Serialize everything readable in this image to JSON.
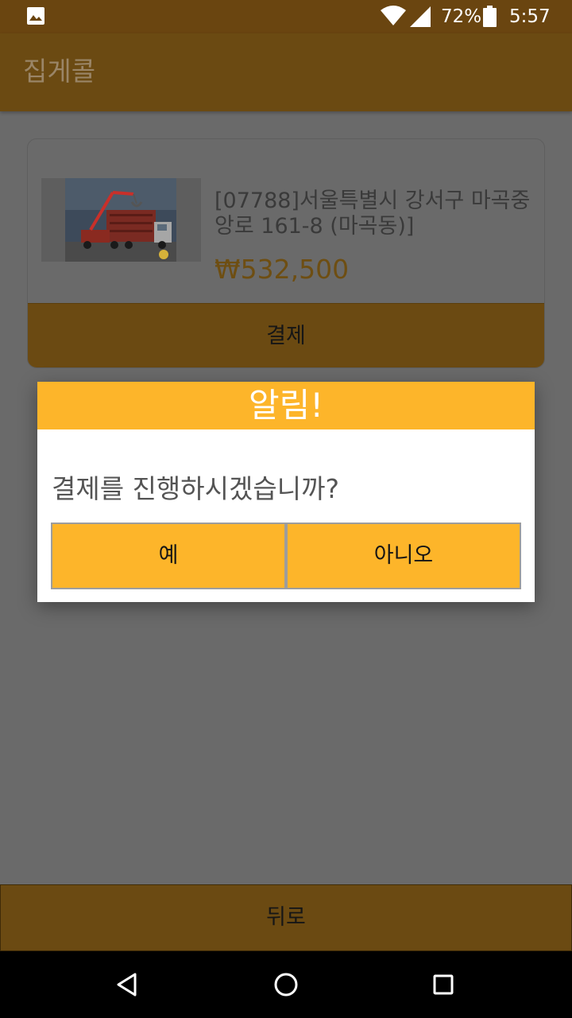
{
  "status_bar": {
    "battery_percent": "72%",
    "time": "5:57",
    "icons": [
      "image-notification-icon",
      "wifi-icon",
      "cell-signal-icon",
      "battery-icon"
    ]
  },
  "app_bar": {
    "title": "집게콜"
  },
  "order": {
    "address": "[07788]서울특별시 강서구 마곡중앙로 161-8 (마곡동)]",
    "price": "₩532,500",
    "pay_label": "결제"
  },
  "dialog": {
    "title": "알림!",
    "message": "결제를 진행하시겠습니까?",
    "yes_label": "예",
    "no_label": "아니오"
  },
  "back_label": "뒤로",
  "nav": {
    "icons": [
      "back-triangle-icon",
      "home-circle-icon",
      "recents-square-icon"
    ]
  },
  "colors": {
    "accent": "#fdb52a",
    "dimmed_accent": "#6b4a12",
    "scrim_background": "#6a6a6a"
  }
}
